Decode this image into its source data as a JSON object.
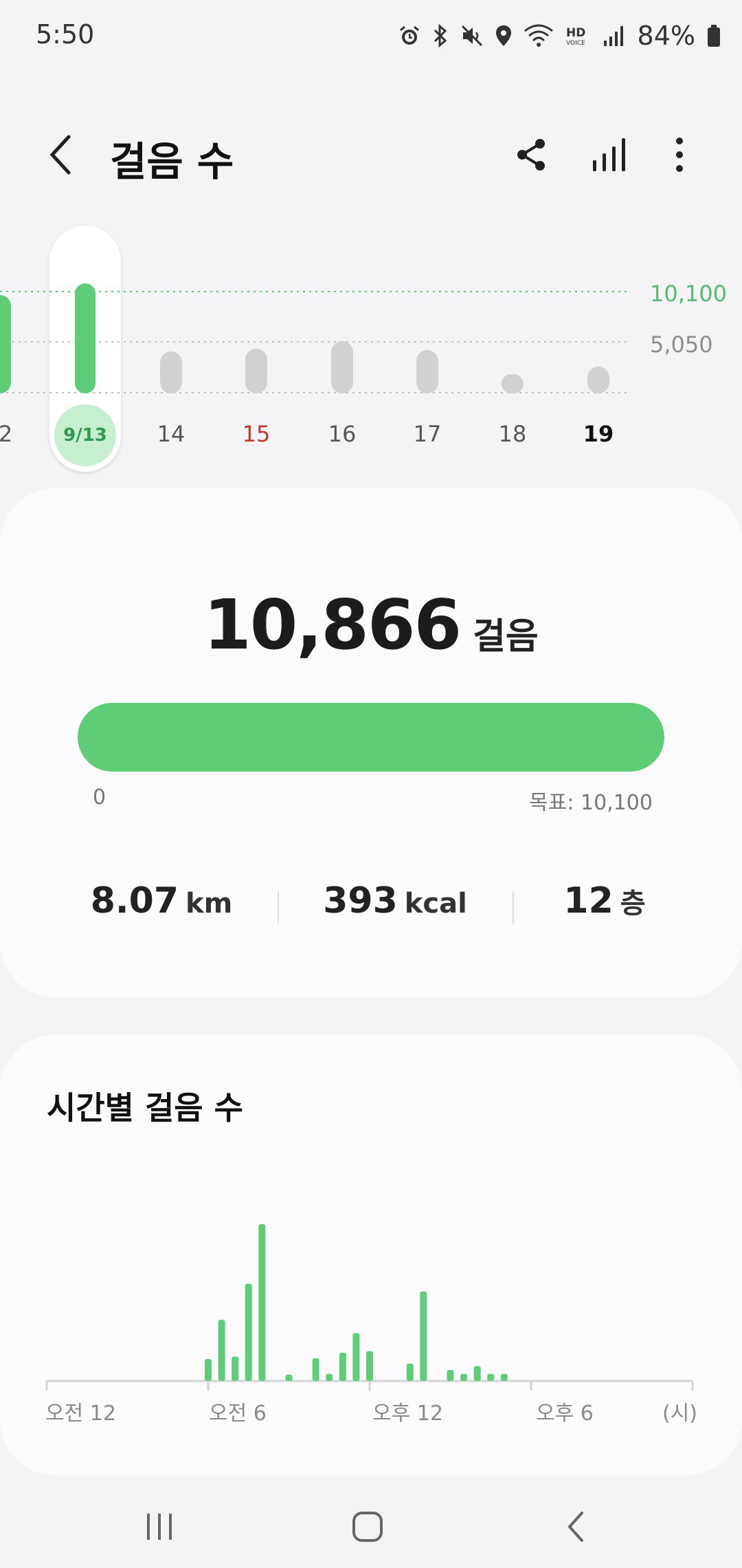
{
  "status": {
    "time": "5:50",
    "battery_pct": "84%",
    "icons": [
      "alarm-icon",
      "bluetooth-icon",
      "mute-icon",
      "location-icon",
      "wifi-icon",
      "hd-voice-icon",
      "signal-icon",
      "battery-icon"
    ]
  },
  "header": {
    "title": "걸음 수",
    "icons": [
      "back-icon",
      "share-icon",
      "bar-chart-icon",
      "more-icon"
    ]
  },
  "week_chart": {
    "goal_label": "10,100",
    "half_label": "5,050",
    "goal": 10100,
    "days": [
      {
        "label": "2",
        "steps": 9800,
        "color": "green",
        "style": "normal"
      },
      {
        "label": "9/13",
        "steps": 10866,
        "color": "green",
        "style": "selected"
      },
      {
        "label": "14",
        "steps": 4200,
        "color": "gray",
        "style": "normal"
      },
      {
        "label": "15",
        "steps": 4500,
        "color": "gray",
        "style": "sunday"
      },
      {
        "label": "16",
        "steps": 5200,
        "color": "gray",
        "style": "normal"
      },
      {
        "label": "17",
        "steps": 4300,
        "color": "gray",
        "style": "normal"
      },
      {
        "label": "18",
        "steps": 400,
        "color": "gray",
        "style": "normal"
      },
      {
        "label": "19",
        "steps": 2700,
        "color": "gray",
        "style": "today"
      }
    ]
  },
  "summary": {
    "steps_value": "10,866",
    "steps_unit": "걸음",
    "progress_fraction": 1.0,
    "progress_min": "0",
    "progress_goal": "목표: 10,100",
    "distance_value": "8.07",
    "distance_unit": "km",
    "calories_value": "393",
    "calories_unit": "kcal",
    "floors_value": "12",
    "floors_unit": "층"
  },
  "hourly": {
    "title": "시간별 걸음 수",
    "x_labels": [
      "오전 12",
      "오전 6",
      "오후 12",
      "오후 6",
      "(시)"
    ],
    "bars": [
      {
        "hour": 6.0,
        "value": 280
      },
      {
        "hour": 6.5,
        "value": 780
      },
      {
        "hour": 7.0,
        "value": 310
      },
      {
        "hour": 7.5,
        "value": 1240
      },
      {
        "hour": 8.0,
        "value": 2000
      },
      {
        "hour": 9.0,
        "value": 80
      },
      {
        "hour": 10.0,
        "value": 290
      },
      {
        "hour": 10.5,
        "value": 90
      },
      {
        "hour": 11.0,
        "value": 360
      },
      {
        "hour": 11.5,
        "value": 610
      },
      {
        "hour": 12.0,
        "value": 380
      },
      {
        "hour": 13.5,
        "value": 220
      },
      {
        "hour": 14.0,
        "value": 1140
      },
      {
        "hour": 15.0,
        "value": 140
      },
      {
        "hour": 15.5,
        "value": 90
      },
      {
        "hour": 16.0,
        "value": 190
      },
      {
        "hour": 16.5,
        "value": 90
      },
      {
        "hour": 17.0,
        "value": 90
      }
    ]
  },
  "colors": {
    "accent_green": "#5fcd78",
    "sunday_red": "#c0392b",
    "bar_gray": "#d1d1d3"
  },
  "nav": {
    "icons": [
      "recents-icon",
      "home-icon",
      "back-nav-icon"
    ]
  }
}
